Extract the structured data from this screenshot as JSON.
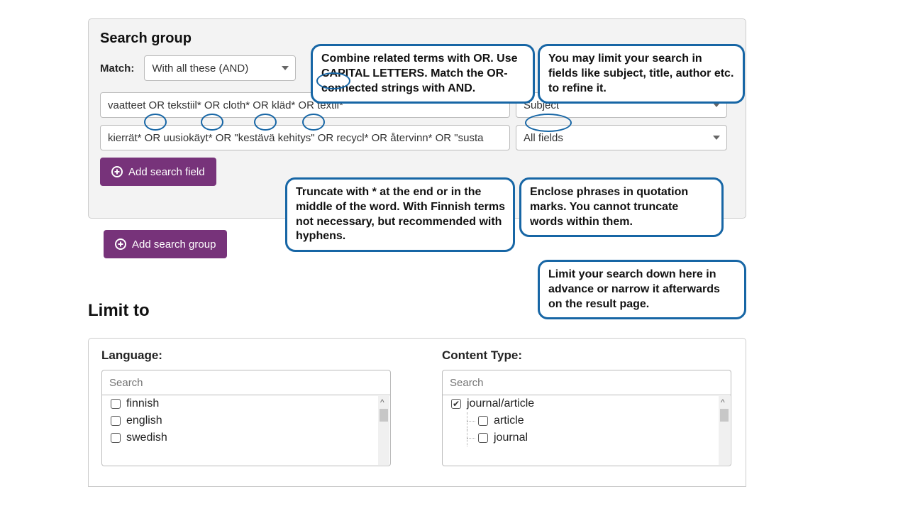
{
  "searchGroup": {
    "title": "Search group",
    "matchLabel": "Match:",
    "matchValue": "With all these (AND)",
    "rows": [
      {
        "query": "vaatteet OR tekstiil* OR cloth* OR kläd* OR textil*",
        "field": "Subject"
      },
      {
        "query": "kierrät* OR uusiokäyt* OR \"kestävä kehitys\" OR recycl* OR återvinn* OR \"susta",
        "field": "All fields"
      }
    ],
    "addFieldLabel": "Add search field",
    "addGroupLabel": "Add search group"
  },
  "callouts": {
    "c1": "Combine related terms with OR. Use CAPITAL LETTERS. Match the OR-connected strings with AND.",
    "c2": "You may limit your search in fields like subject, title, author etc. to refine it.",
    "c3": "Truncate with * at the end or in the middle of the word. With Finnish terms not necessary, but recommended with hyphens.",
    "c4": "Enclose phrases in quotation marks. You cannot truncate words within them.",
    "c5": "Limit your search down here in advance or narrow it afterwards on the result page."
  },
  "limit": {
    "title": "Limit to",
    "language": {
      "label": "Language:",
      "placeholder": "Search",
      "items": [
        "finnish",
        "english",
        "swedish"
      ]
    },
    "contentType": {
      "label": "Content Type:",
      "placeholder": "Search",
      "root": "journal/article",
      "children": [
        "article",
        "journal"
      ]
    }
  },
  "icons": {
    "plus": "plus-circle"
  }
}
